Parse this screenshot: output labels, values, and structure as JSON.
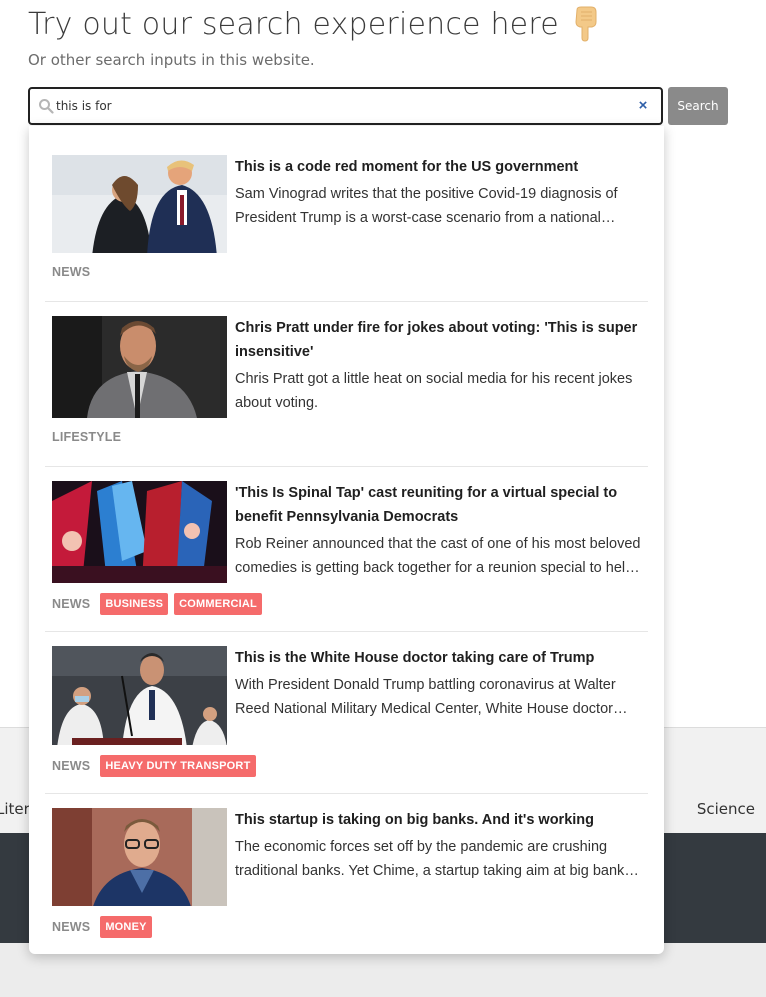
{
  "header": {
    "title": "Try out our search experience here",
    "subtitle": "Or other search inputs in this website."
  },
  "search": {
    "value": "this is for",
    "button_label": "Search",
    "clear_symbol": "×"
  },
  "background_nav": {
    "left_label": "Liter",
    "right_label": "Science"
  },
  "colors": {
    "tag_bg": "#f56b6b",
    "dark_band": "#343a40",
    "button_bg": "#8a8a8a"
  },
  "results": [
    {
      "title": "This is a code red moment for the US government",
      "summary": "Sam Vinograd writes that the positive Covid-19 diagnosis of President Trump is a worst-case scenario from a national security perspective.",
      "category": "NEWS",
      "tags": [],
      "image": "photo-couple-walking"
    },
    {
      "title": "Chris Pratt under fire for jokes about voting: 'This is super insensitive'",
      "summary": "Chris Pratt got a little heat on social media for his recent jokes about voting.",
      "category": "LIFESTYLE",
      "tags": [],
      "image": "photo-man-in-suit"
    },
    {
      "title": "'This Is Spinal Tap' cast reuniting for a virtual special to benefit Pennsylvania Democrats",
      "summary": "Rob Reiner announced that the cast of one of his most beloved comedies is getting back together for a reunion special to help Pennsylvania Democrats.",
      "category": "NEWS",
      "tags": [
        "BUSINESS",
        "COMMERCIAL"
      ],
      "image": "photo-stage-concert"
    },
    {
      "title": "This is the White House doctor taking care of Trump",
      "summary": "With President Donald Trump battling coronavirus at Walter Reed National Military Medical Center, White House doctor Sean Conley has briefed the press.",
      "category": "NEWS",
      "tags": [
        "HEAVY DUTY TRANSPORT"
      ],
      "image": "photo-doctor-podium"
    },
    {
      "title": "This startup is taking on big banks. And it's working",
      "summary": "The economic forces set off by the pandemic are crushing traditional banks. Yet Chime, a startup taking aim at big banks, is thriving.",
      "category": "NEWS",
      "tags": [
        "MONEY"
      ],
      "image": "photo-man-glasses"
    }
  ]
}
